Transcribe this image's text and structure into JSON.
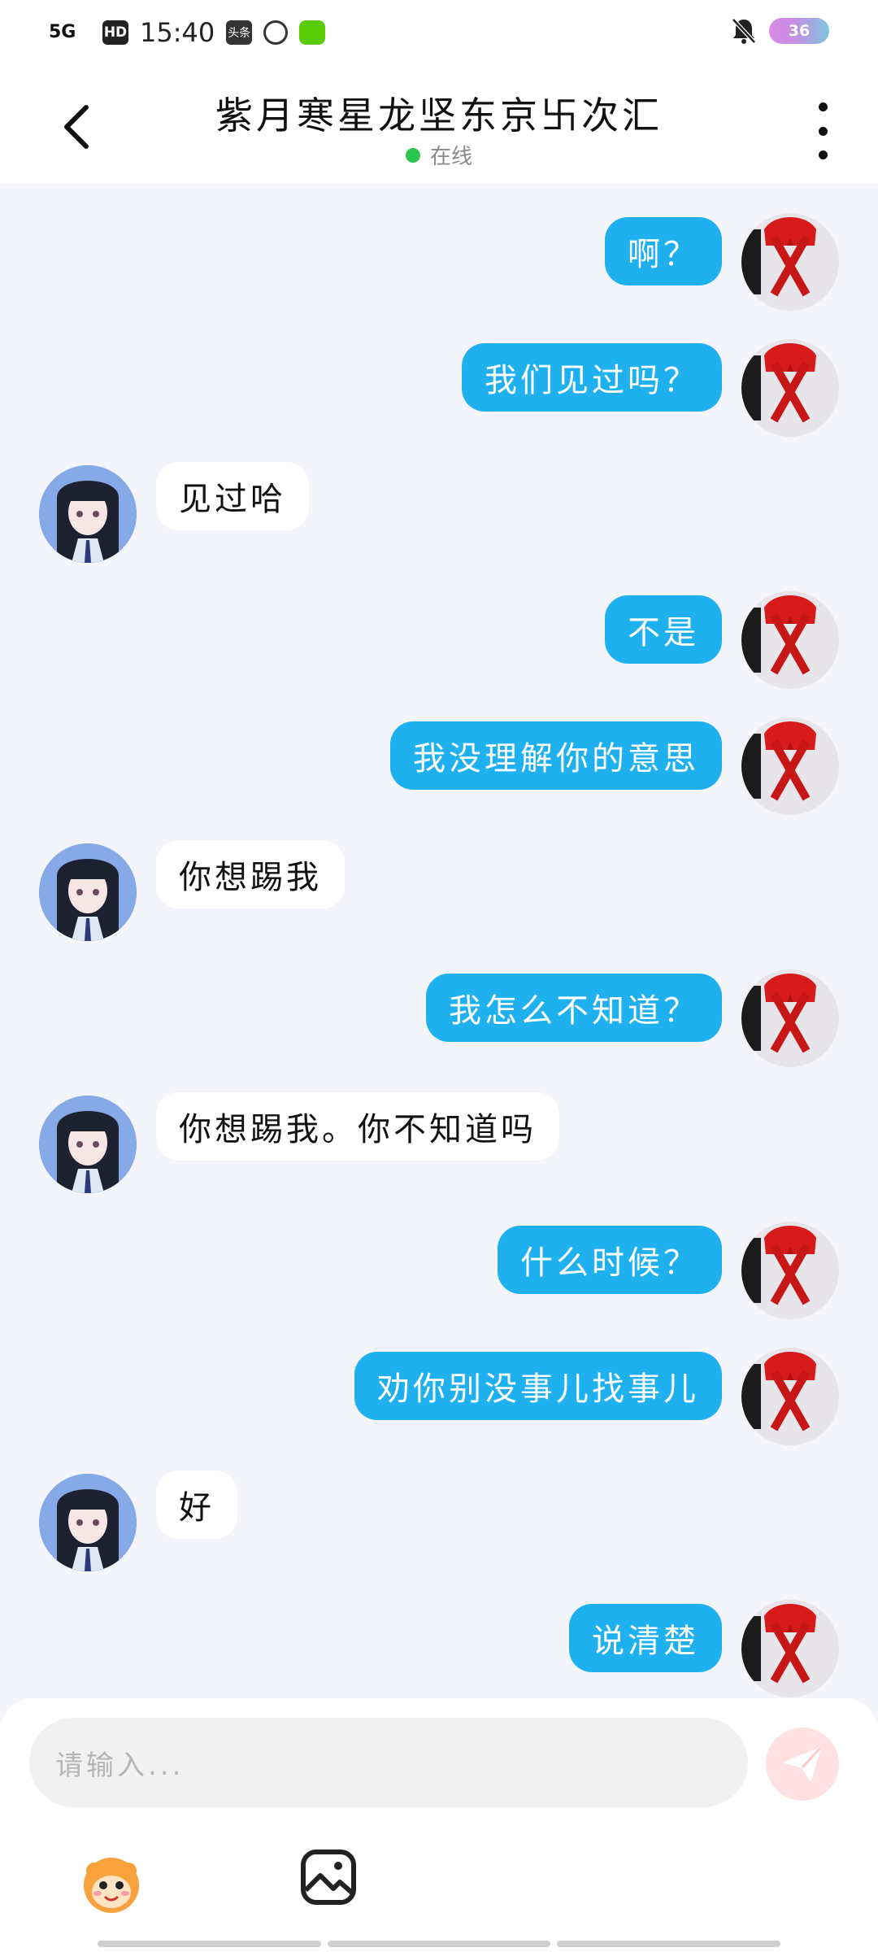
{
  "status_bar": {
    "network": "5G",
    "hd": "HD",
    "time": "15:40",
    "app_badge": "头条",
    "battery": "36"
  },
  "header": {
    "title": "紫月寒星龙坚东京卐次汇",
    "status": "在线"
  },
  "messages": [
    {
      "side": "me",
      "text": "啊？"
    },
    {
      "side": "me",
      "text": "我们见过吗？"
    },
    {
      "side": "bot",
      "text": "见过哈"
    },
    {
      "side": "me",
      "text": "不是"
    },
    {
      "side": "me",
      "text": "我没理解你的意思"
    },
    {
      "side": "bot",
      "text": "你想踢我"
    },
    {
      "side": "me",
      "text": "我怎么不知道？"
    },
    {
      "side": "bot",
      "text": "你想踢我。你不知道吗"
    },
    {
      "side": "me",
      "text": "什么时候？"
    },
    {
      "side": "me",
      "text": "劝你别没事儿找事儿"
    },
    {
      "side": "bot",
      "text": "好"
    },
    {
      "side": "me",
      "text": "说清楚"
    }
  ],
  "composer": {
    "placeholder": "请输入..."
  },
  "icons": {
    "back": "chevron-left-icon",
    "more": "more-vertical-icon",
    "send": "send-icon",
    "emoji": "emoji-mascot-icon",
    "image": "image-icon"
  },
  "colors": {
    "my_bubble": "#1fb0ef",
    "bot_bubble": "#ffffff",
    "online_dot": "#2bc44c",
    "chat_bg": "#f3f5fa"
  }
}
